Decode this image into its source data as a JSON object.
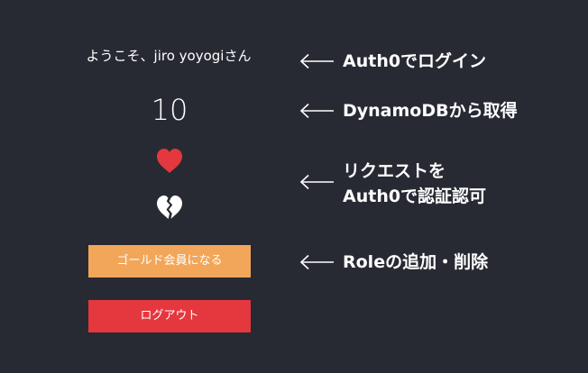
{
  "app": {
    "welcome_text": "ようこそ、jiro yoyogiさん",
    "count": "10",
    "like_icon": "heart-icon",
    "unlike_icon": "broken-heart-icon",
    "member_button_label": "ゴールド会員になる",
    "logout_button_label": "ログアウト"
  },
  "annotations": [
    {
      "arrow_icon": "left-arrow-icon",
      "lines": [
        "Auth0でログイン"
      ]
    },
    {
      "arrow_icon": "left-arrow-icon",
      "lines": [
        "DynamoDBから取得"
      ]
    },
    {
      "arrow_icon": "left-arrow-icon",
      "lines": [
        "リクエストを",
        "Auth0で認証認可"
      ]
    },
    {
      "arrow_icon": "left-arrow-icon",
      "lines": [
        "Roleの追加・削除"
      ]
    }
  ],
  "colors": {
    "background": "#282a33",
    "text": "#ffffff",
    "heart": "#e4383e",
    "broken_heart": "#ffffff",
    "member_button": "#f2a65a",
    "logout_button": "#e4383e"
  }
}
